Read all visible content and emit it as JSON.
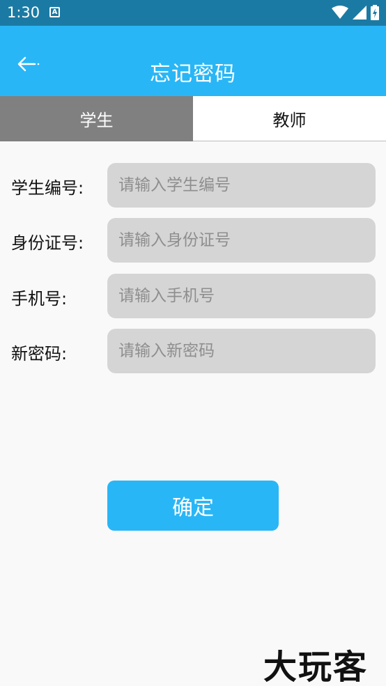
{
  "status_bar": {
    "time": "1:30",
    "notification_letter": "A",
    "icons": [
      "wifi-icon",
      "signal-icon",
      "battery-charging-icon"
    ]
  },
  "app_bar": {
    "back_icon": "arrow-left-icon",
    "title": "忘记密码"
  },
  "tabs": [
    {
      "label": "学生",
      "active": true
    },
    {
      "label": "教师",
      "active": false
    }
  ],
  "form": {
    "fields": [
      {
        "label": "学生编号:",
        "placeholder": "请输入学生编号",
        "value": ""
      },
      {
        "label": "身份证号:",
        "placeholder": "请输入身份证号",
        "value": ""
      },
      {
        "label": "手机号:",
        "placeholder": "请输入手机号",
        "value": ""
      },
      {
        "label": "新密码:",
        "placeholder": "请输入新密码",
        "value": ""
      }
    ],
    "submit_label": "确定"
  },
  "watermark": "大玩客",
  "colors": {
    "status_bar": "#1b7aa3",
    "accent": "#29b6f6",
    "tab_active": "#808080",
    "input_bg": "#d5d5d5"
  }
}
